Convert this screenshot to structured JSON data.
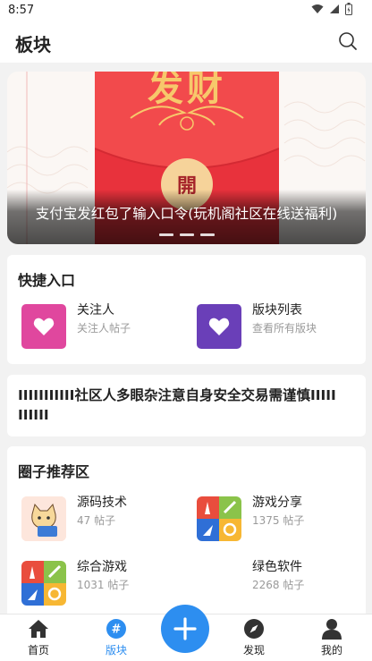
{
  "status": {
    "time": "8:57"
  },
  "header": {
    "title": "板块"
  },
  "banner": {
    "caption": "支付宝发红包了输入口令(玩机阁社区在线送福利)",
    "card_text": "发财",
    "seal_text": "開",
    "slide_count": 3
  },
  "quick": {
    "title": "快捷入口",
    "items": [
      {
        "title": "关注人",
        "subtitle": "关注人帖子",
        "color": "#e0479e"
      },
      {
        "title": "版块列表",
        "subtitle": "查看所有版块",
        "color": "#6a3fb8"
      }
    ]
  },
  "notice": {
    "text": "IIIIIIIIIII社区人多眼杂注意自身安全交易需谨慎IIIIIIIIIII"
  },
  "circles": {
    "title": "圈子推荐区",
    "items": [
      {
        "name": "源码技术",
        "count": "47 帖子",
        "icon": "cat-laptop-icon"
      },
      {
        "name": "游戏分享",
        "count": "1375 帖子",
        "icon": "game-tiles-icon"
      },
      {
        "name": "综合游戏",
        "count": "1031 帖子",
        "icon": "game-tiles-icon"
      },
      {
        "name": "绿色软件",
        "count": "2268 帖子",
        "icon": ""
      }
    ]
  },
  "tabs": [
    {
      "label": "首页",
      "icon": "home-icon",
      "active": false
    },
    {
      "label": "版块",
      "icon": "hash-icon",
      "active": true
    },
    {
      "label": "发现",
      "icon": "compass-icon",
      "active": false
    },
    {
      "label": "我的",
      "icon": "person-icon",
      "active": false
    }
  ],
  "colors": {
    "accent": "#2d8ef0",
    "banner_red": "#e8323c"
  }
}
